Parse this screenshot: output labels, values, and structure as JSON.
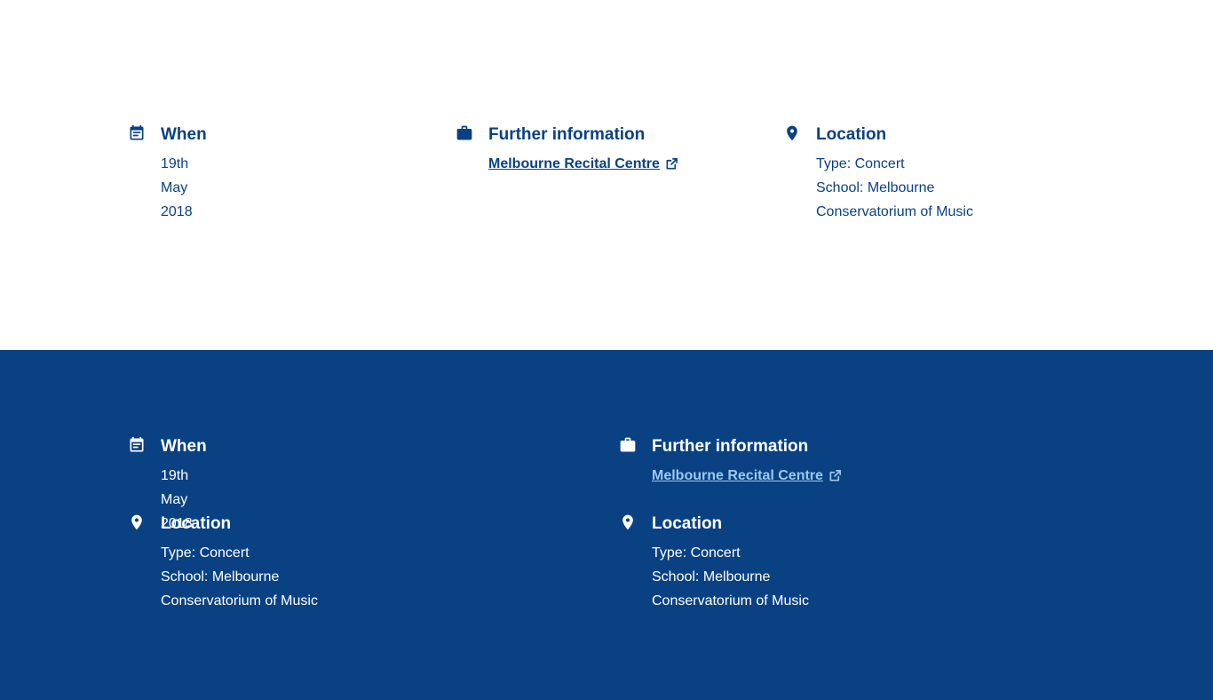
{
  "light_section": {
    "when": {
      "icon": "calendar-icon",
      "title": "When",
      "value": "19th May 2018"
    },
    "further_info": {
      "icon": "briefcase-icon",
      "title": "Further information",
      "link_label": "Melbourne Recital Centre",
      "link_icon": "external-link-icon"
    },
    "location": {
      "icon": "map-pin-icon",
      "title": "Location",
      "type_line": "Type: Concert",
      "school_line1": "School: Melbourne",
      "school_line2": "Conservatorium of Music"
    }
  },
  "dark_section": {
    "when": {
      "icon": "calendar-icon",
      "title": "When",
      "value": "19th May 2018"
    },
    "further_info": {
      "icon": "briefcase-icon",
      "title": "Further information",
      "link_label": "Melbourne Recital Centre",
      "link_icon": "external-link-icon"
    },
    "location_left": {
      "icon": "map-pin-icon",
      "title": "Location",
      "type_line": "Type: Concert",
      "school_line1": "School: Melbourne",
      "school_line2": "Conservatorium of Music"
    },
    "location_right": {
      "icon": "map-pin-icon",
      "title": "Location",
      "type_line": "Type: Concert",
      "school_line1": "School: Melbourne",
      "school_line2": "Conservatorium of Music"
    }
  },
  "colors": {
    "brand_navy": "#094183",
    "light_link_on_dark": "#9ec9ee",
    "background_light": "#ffffff"
  }
}
